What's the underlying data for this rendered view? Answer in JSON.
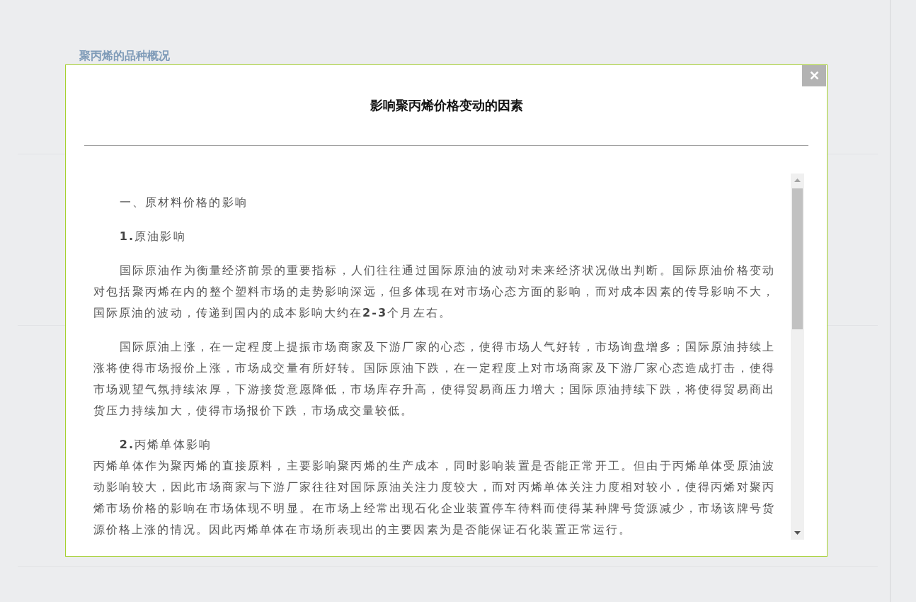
{
  "background": {
    "heading": "聚丙烯的品种概况"
  },
  "dialog": {
    "title": "影响聚丙烯价格变动的因素",
    "close": "✕",
    "paragraphs": [
      {
        "kind": "heading",
        "text": "一、原材料价格的影响"
      },
      {
        "kind": "heading",
        "text": "**1.**原油影响"
      },
      {
        "kind": "text",
        "text": "国际原油作为衡量经济前景的重要指标，人们往往通过国际原油的波动对未来经济状况做出判断。国际原油价格变动对包括聚丙烯在内的整个塑料市场的走势影响深远，但多体现在对市场心态方面的影响，而对成本因素的传导影响不大，国际原油的波动，传递到国内的成本影响大约在**2-3**个月左右。"
      },
      {
        "kind": "text",
        "text": "国际原油上涨，在一定程度上提振市场商家及下游厂家的心态，使得市场人气好转，市场询盘增多；国际原油持续上涨将使得市场报价上涨，市场成交量有所好转。国际原油下跌，在一定程度上对市场商家及下游厂家心态造成打击，使得市场观望气氛持续浓厚，下游接货意愿降低，市场库存升高，使得贸易商压力增大；国际原油持续下跌，将使得贸易商出货压力持续加大，使得市场报价下跌，市场成交量较低。"
      },
      {
        "kind": "heading-tight",
        "text": "**2.**丙烯单体影响"
      },
      {
        "kind": "plain",
        "text": "丙烯单体作为聚丙烯的直接原料，主要影响聚丙烯的生产成本，同时影响装置是否能正常开工。但由于丙烯单体受原油波动影响较大，因此市场商家与下游厂家往往对国际原油关注力度较大，而对丙烯单体关注力度相对较小，使得丙烯对聚丙烯市场价格的影响在市场体现不明显。在市场上经常出现石化企业装置停车待料而使得某种牌号货源减少，市场该牌号货源价格上涨的情况。因此丙烯单体在市场所表现出的主要因素为是否能保证石化装置正常运行。"
      }
    ]
  }
}
